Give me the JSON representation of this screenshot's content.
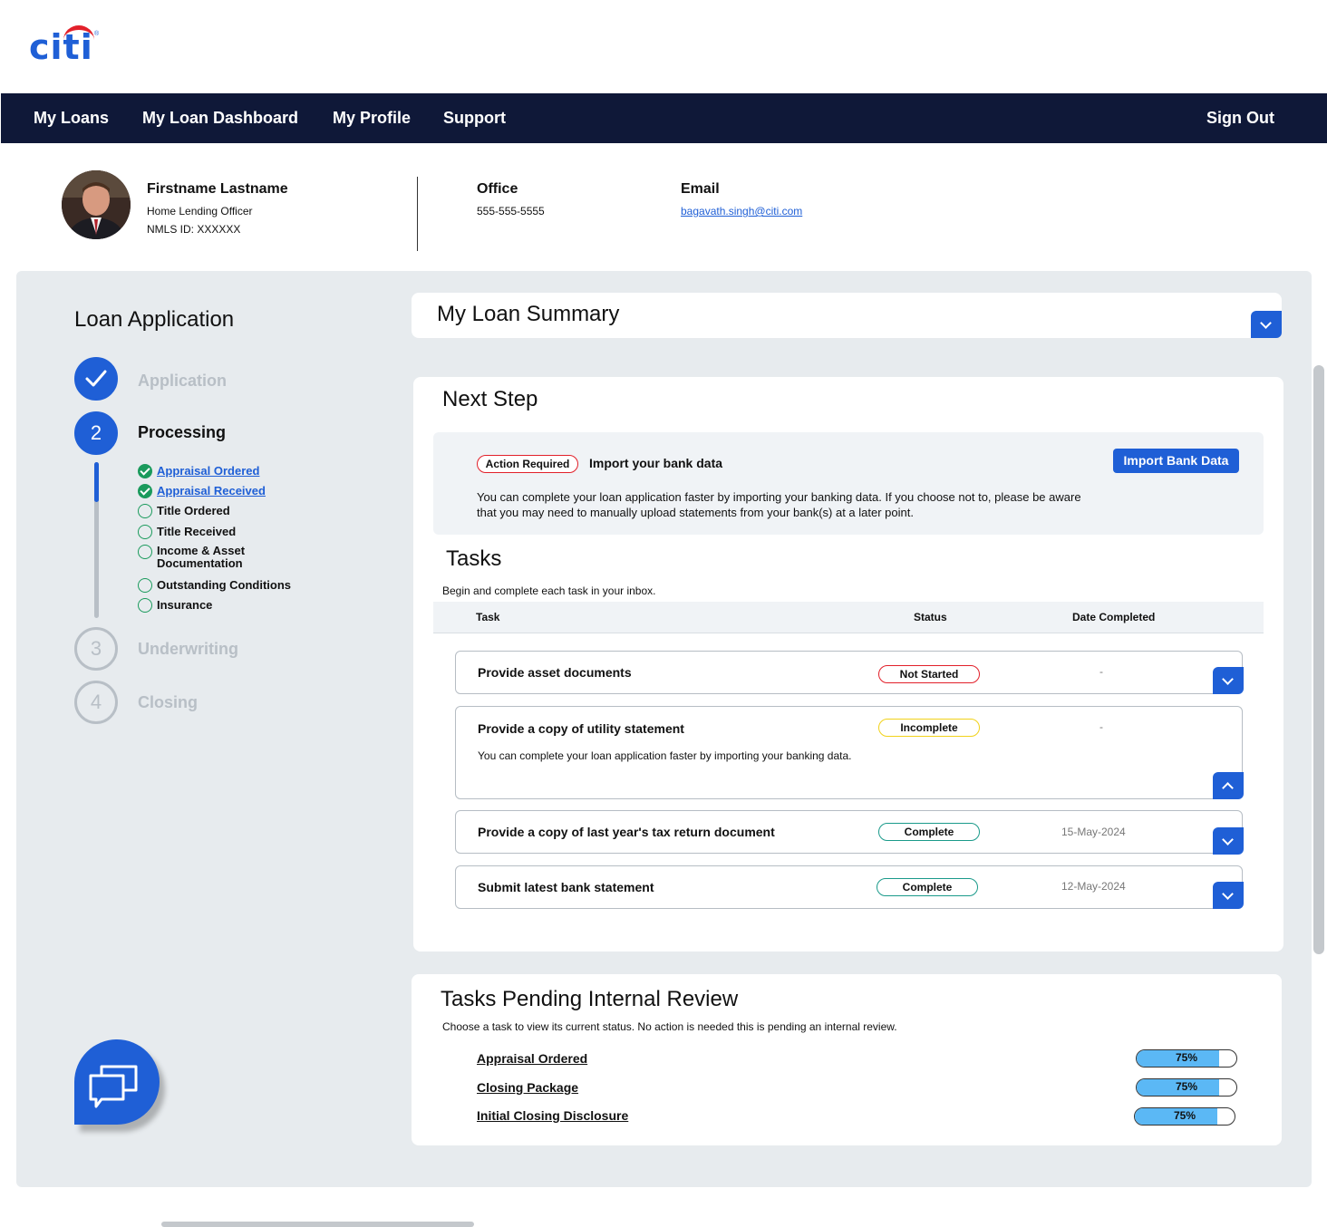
{
  "brand": {
    "logo_text": "citi",
    "registered": "®",
    "blue": "#1f5fd6",
    "red": "#e2202a"
  },
  "nav": {
    "items": [
      "My Loans",
      "My Loan Dashboard",
      "My Profile",
      "Support"
    ],
    "sign_out": "Sign Out"
  },
  "officer": {
    "name": "Firstname Lastname",
    "title": "Home Lending Officer",
    "nmls": "NMLS ID: XXXXXX",
    "office_label": "Office",
    "office_phone": "555-555-5555",
    "email_label": "Email",
    "email": "bagavath.singh@citi.com"
  },
  "sidebar": {
    "title": "Loan Application",
    "steps": [
      {
        "number": "",
        "label": "Application",
        "state": "done"
      },
      {
        "number": "2",
        "label": "Processing",
        "state": "current"
      },
      {
        "number": "3",
        "label": "Underwriting",
        "state": "todo"
      },
      {
        "number": "4",
        "label": "Closing",
        "state": "todo"
      }
    ],
    "substeps": [
      {
        "label": "Appraisal Ordered",
        "done": true
      },
      {
        "label": "Appraisal Received",
        "done": true
      },
      {
        "label": "Title Ordered",
        "done": false
      },
      {
        "label": "Title Received",
        "done": false
      },
      {
        "label": "Income & Asset Documentation",
        "done": false
      },
      {
        "label": "Outstanding Conditions",
        "done": false
      },
      {
        "label": "Insurance",
        "done": false
      }
    ]
  },
  "summary": {
    "title": "My Loan Summary"
  },
  "next_step": {
    "title": "Next Step",
    "badge": "Action Required",
    "heading": "Import your bank data",
    "description": "You can complete your loan application faster by importing your banking data. If you choose not to, please be aware that you may need to manually upload statements from your bank(s) at a later point.",
    "button": "Import Bank Data"
  },
  "tasks": {
    "title": "Tasks",
    "subtitle": "Begin and complete each task in your inbox.",
    "columns": {
      "task": "Task",
      "status": "Status",
      "date": "Date Completed"
    },
    "rows": [
      {
        "name": "Provide asset documents",
        "status": "Not Started",
        "date": "-",
        "expanded": false
      },
      {
        "name": "Provide a copy of utility statement",
        "status": "Incomplete",
        "date": "-",
        "expanded": true,
        "detail": "You can complete your loan application faster by importing your banking data."
      },
      {
        "name": "Provide a copy of last year's tax return document",
        "status": "Complete",
        "date": "15-May-2024",
        "expanded": false
      },
      {
        "name": "Submit latest bank statement",
        "status": "Complete",
        "date": "12-May-2024",
        "expanded": false
      }
    ]
  },
  "pending": {
    "title": "Tasks Pending Internal Review",
    "subtitle": "Choose a task to view its current status. No action is needed this is pending an internal review.",
    "items": [
      {
        "name": "Appraisal Ordered",
        "progress": 75,
        "progress_label": "75%"
      },
      {
        "name": "Closing Package",
        "progress": 75,
        "progress_label": "75%"
      },
      {
        "name": "Initial Closing Disclosure",
        "progress": 75,
        "progress_label": "75%"
      }
    ]
  }
}
